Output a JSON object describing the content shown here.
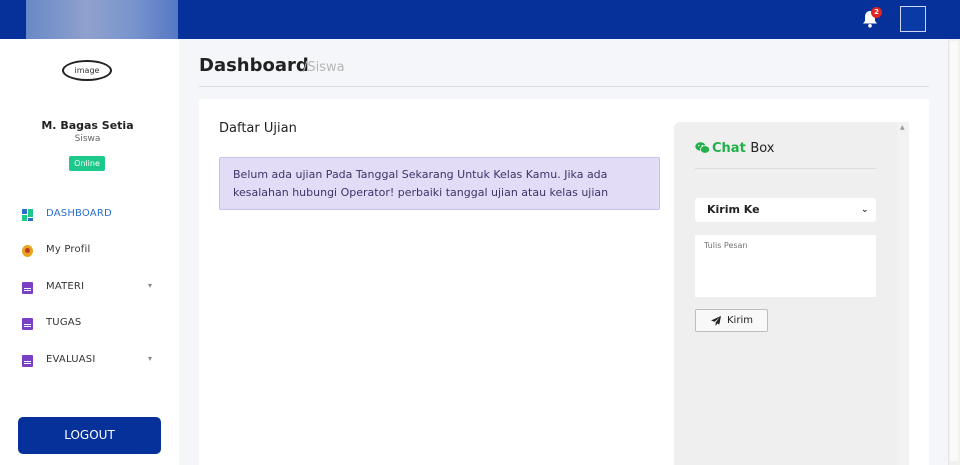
{
  "topbar": {
    "notification_count": "2"
  },
  "profile": {
    "logo_alt": "image",
    "name": "M. Bagas Setia",
    "role": "Siswa",
    "status": "Online"
  },
  "sidebar": {
    "items": [
      {
        "label": "DASHBOARD",
        "icon": "dashboard-icon",
        "active": true
      },
      {
        "label": "My Profil",
        "icon": "profile-icon"
      },
      {
        "label": "MATERI",
        "icon": "document-icon",
        "expandable": true
      },
      {
        "label": "TUGAS",
        "icon": "document-icon"
      },
      {
        "label": "EVALUASI",
        "icon": "document-icon",
        "expandable": true
      }
    ],
    "logout_label": "LOGOUT"
  },
  "header": {
    "title": "Dashboard",
    "subtitle": "/Siswa"
  },
  "main": {
    "card_title": "Daftar Ujian",
    "alert_text": "Belum ada ujian Pada Tanggal Sekarang Untuk Kelas Kamu. Jika ada kesalahan hubungi Operator! perbaiki tanggal ujian atau kelas ujian"
  },
  "chat": {
    "title_highlight": "Chat",
    "title_rest": "Box",
    "select_value": "Kirim Ke",
    "message_placeholder": "Tulis Pesan",
    "send_label": "Kirim"
  },
  "colors": {
    "primary": "#06309a",
    "online": "#1dc98a",
    "alert_bg": "#e2dcf7",
    "chat_accent": "#22b04a",
    "active_nav": "#2b6fc9"
  }
}
